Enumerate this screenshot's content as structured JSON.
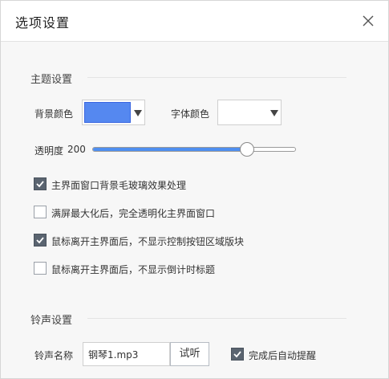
{
  "dialog": {
    "title": "选项设置"
  },
  "theme": {
    "section_title": "主题设置",
    "bg_color_label": "背景颜色",
    "bg_color_value": "#5588f0",
    "font_color_label": "字体颜色",
    "font_color_value": "#ffffff",
    "opacity_label": "透明度",
    "opacity_value": "200",
    "opacity_fraction": 0.76,
    "checkboxes": [
      {
        "label": "主界面窗口背景毛玻璃效果处理",
        "checked": true
      },
      {
        "label": "满屏最大化后，完全透明化主界面窗口",
        "checked": false
      },
      {
        "label": "鼠标离开主界面后，不显示控制按钮区域版块",
        "checked": true
      },
      {
        "label": "鼠标离开主界面后，不显示倒计时标题",
        "checked": false
      }
    ]
  },
  "ringtone": {
    "section_title": "铃声设置",
    "name_label": "铃声名称",
    "name_value": "钢琴1.mp3",
    "test_button": "试听",
    "auto_remind_label": "完成后自动提醒",
    "auto_remind_checked": true
  },
  "colors": {
    "accent": "#4f8ff0",
    "checked_box": "#5a6470"
  }
}
